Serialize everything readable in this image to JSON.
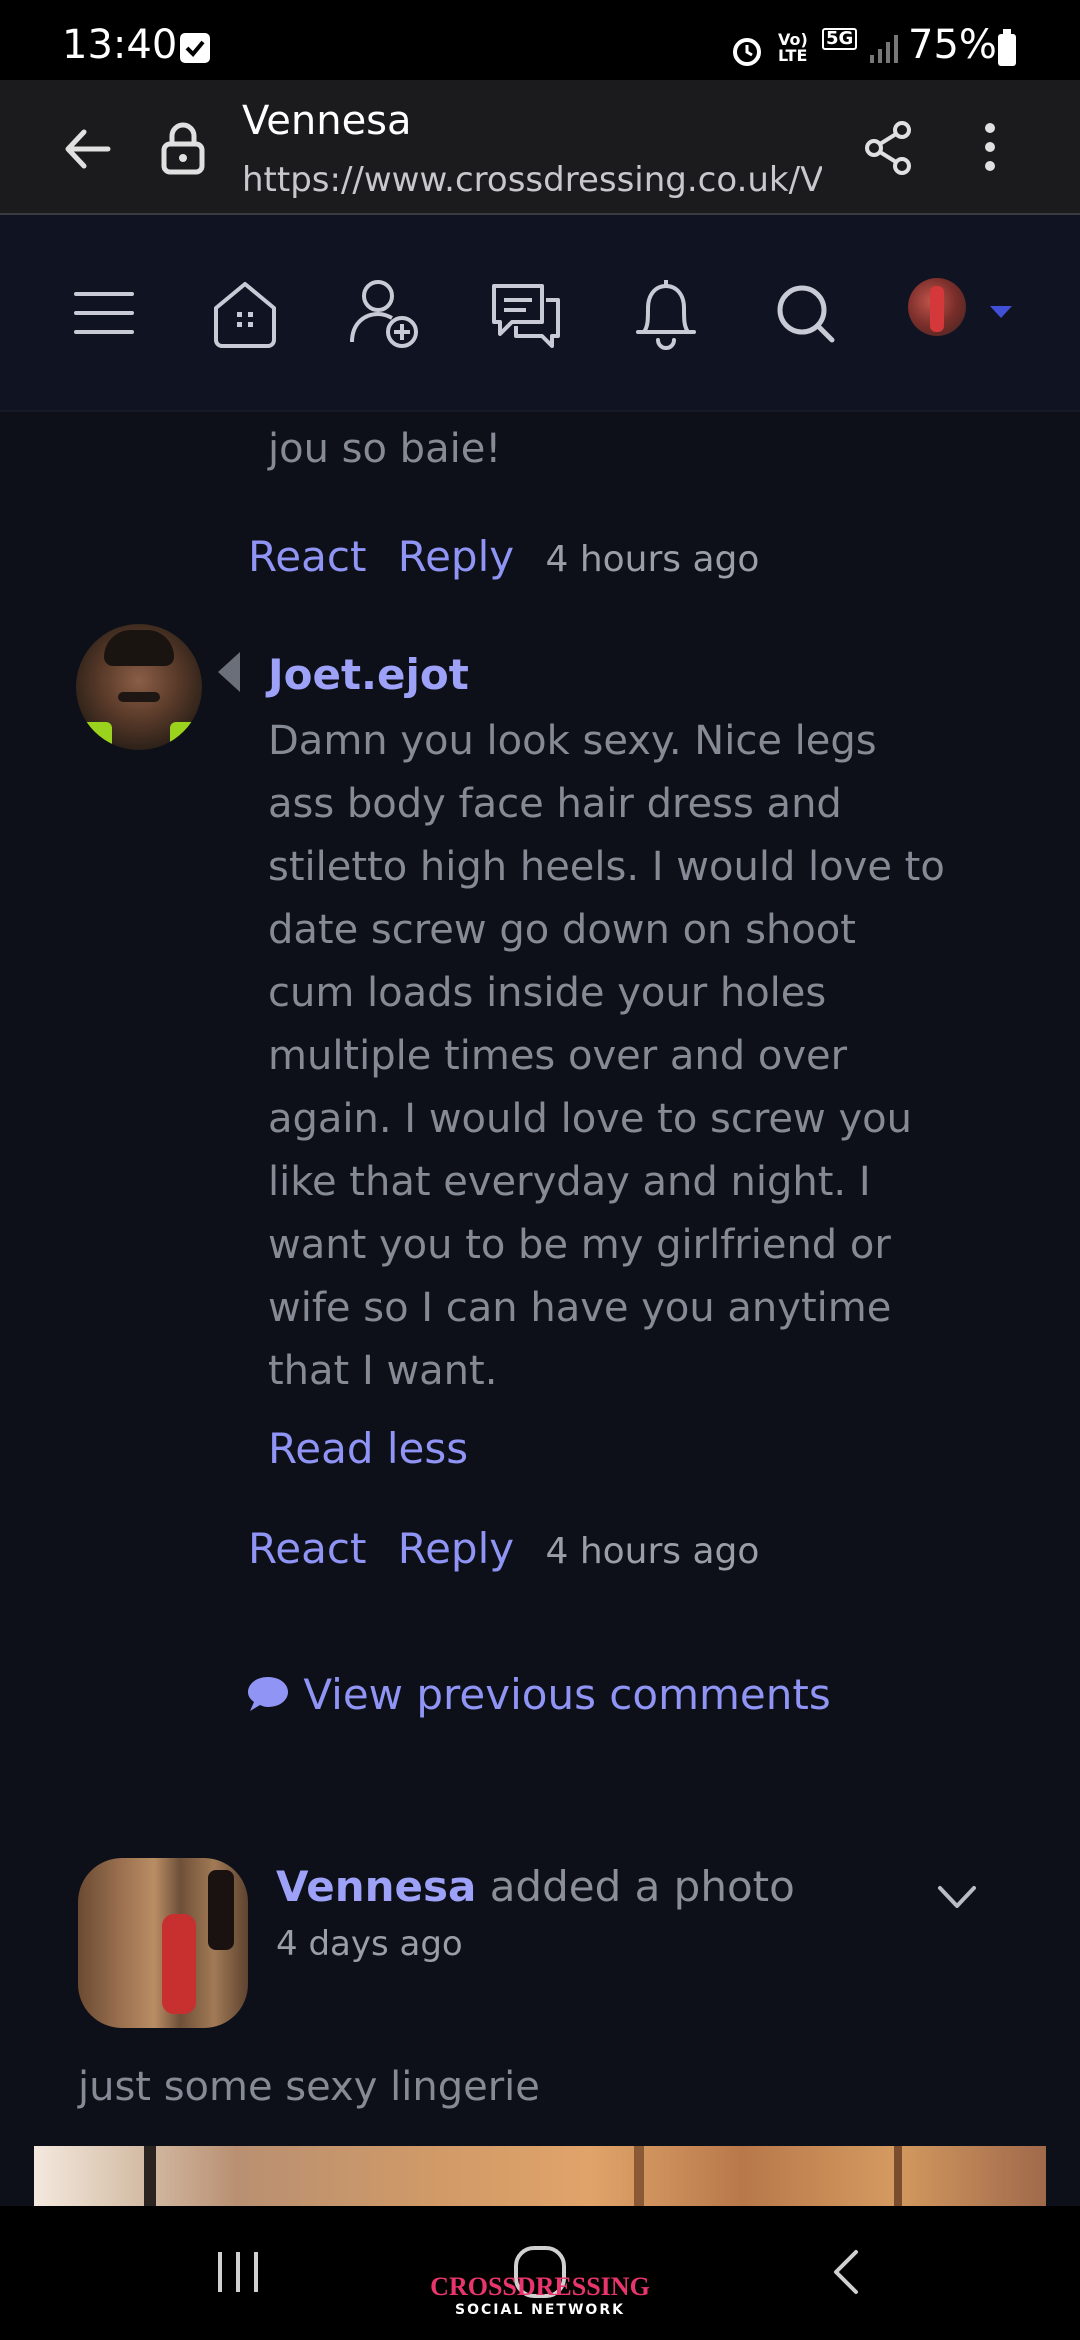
{
  "status_bar": {
    "time": "13:40",
    "network": "5G",
    "volte": "Vo) LTE",
    "battery": "75%"
  },
  "browser": {
    "title": "Vennesa",
    "url": "https://www.crossdressing.co.uk/V"
  },
  "nav_icons": [
    "menu-icon",
    "home-icon",
    "add-friend-icon",
    "messages-icon",
    "notifications-icon",
    "search-icon",
    "user-avatar"
  ],
  "feed": {
    "prev_comment_tail": "jou so baie!",
    "prev_comment_actions": {
      "react": "React",
      "reply": "Reply",
      "time": "4 hours ago"
    },
    "comment": {
      "author": "Joet.ejot",
      "lines": [
        "Damn you look sexy. Nice legs",
        "ass body face hair dress and",
        "stiletto high heels. I would love to",
        "date screw go down on shoot",
        "cum loads inside your holes",
        "multiple times over and over",
        "again. I would love to screw you",
        "like that everyday and night. I",
        "want you to be my girlfriend or",
        "wife so I can have you anytime",
        "that I want."
      ],
      "read_less": "Read less",
      "react": "React",
      "reply": "Reply",
      "time": "4 hours ago"
    },
    "view_previous": "View previous comments",
    "post": {
      "author": "Vennesa",
      "action": "added a photo",
      "time": "4 days ago",
      "caption": "just some sexy lingerie"
    }
  },
  "bottom_nav": {
    "brand": "CROSSDRESSING",
    "brand_sub": "SOCIAL NETWORK"
  },
  "colors": {
    "background": "#0d1018",
    "link": "#8f94f5",
    "body_text": "#858a95",
    "brand": "#e8356b"
  }
}
